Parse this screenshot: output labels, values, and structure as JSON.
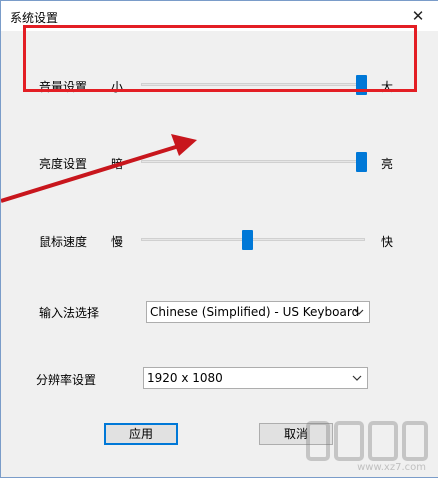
{
  "window": {
    "title": "系统设置",
    "close_glyph": "✕"
  },
  "volume": {
    "label": "音量设置",
    "min_label": "小",
    "max_label": "大",
    "value": 1.0
  },
  "brightness": {
    "label": "亮度设置",
    "min_label": "暗",
    "max_label": "亮",
    "value": 1.0
  },
  "mouse_speed": {
    "label": "鼠标速度",
    "min_label": "慢",
    "max_label": "快",
    "value": 0.47
  },
  "input_method": {
    "label": "输入法选择",
    "selected": "Chinese (Simplified) - US Keyboard"
  },
  "resolution": {
    "label": "分辨率设置",
    "selected": "1920 x 1080"
  },
  "buttons": {
    "apply": "应用",
    "cancel": "取消"
  },
  "annotation": {
    "highlight_color": "#e31e24",
    "arrow_color": "#c8161d"
  },
  "watermark": {
    "text": "www.xz7.com"
  },
  "colors": {
    "accent": "#0078d7",
    "dialog_bg": "#f0f0f0"
  }
}
